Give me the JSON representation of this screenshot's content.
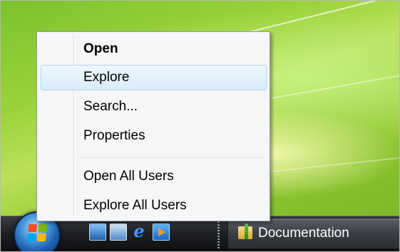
{
  "context_menu": {
    "items": [
      {
        "label": "Open",
        "bold": true,
        "highlighted": false
      },
      {
        "label": "Explore",
        "bold": false,
        "highlighted": true
      },
      {
        "label": "Search...",
        "bold": false,
        "highlighted": false
      },
      {
        "label": "Properties",
        "bold": false,
        "highlighted": false
      }
    ],
    "items_after_separator": [
      {
        "label": "Open All Users"
      },
      {
        "label": "Explore All Users"
      }
    ]
  },
  "taskbar": {
    "start_button_icon": "windows-logo-icon",
    "quick_launch": [
      {
        "name": "show-desktop-icon"
      },
      {
        "name": "switch-windows-icon"
      },
      {
        "name": "internet-explorer-icon",
        "glyph": "e"
      },
      {
        "name": "media-player-icon"
      }
    ],
    "window_button": {
      "label": "Documentation",
      "icon": "folder-icon"
    }
  },
  "colors": {
    "menu_background": "#f5f6f7",
    "menu_highlight": "#d8ecf9",
    "taskbar": "#1f2124",
    "desktop_green": "#9ad23a"
  }
}
